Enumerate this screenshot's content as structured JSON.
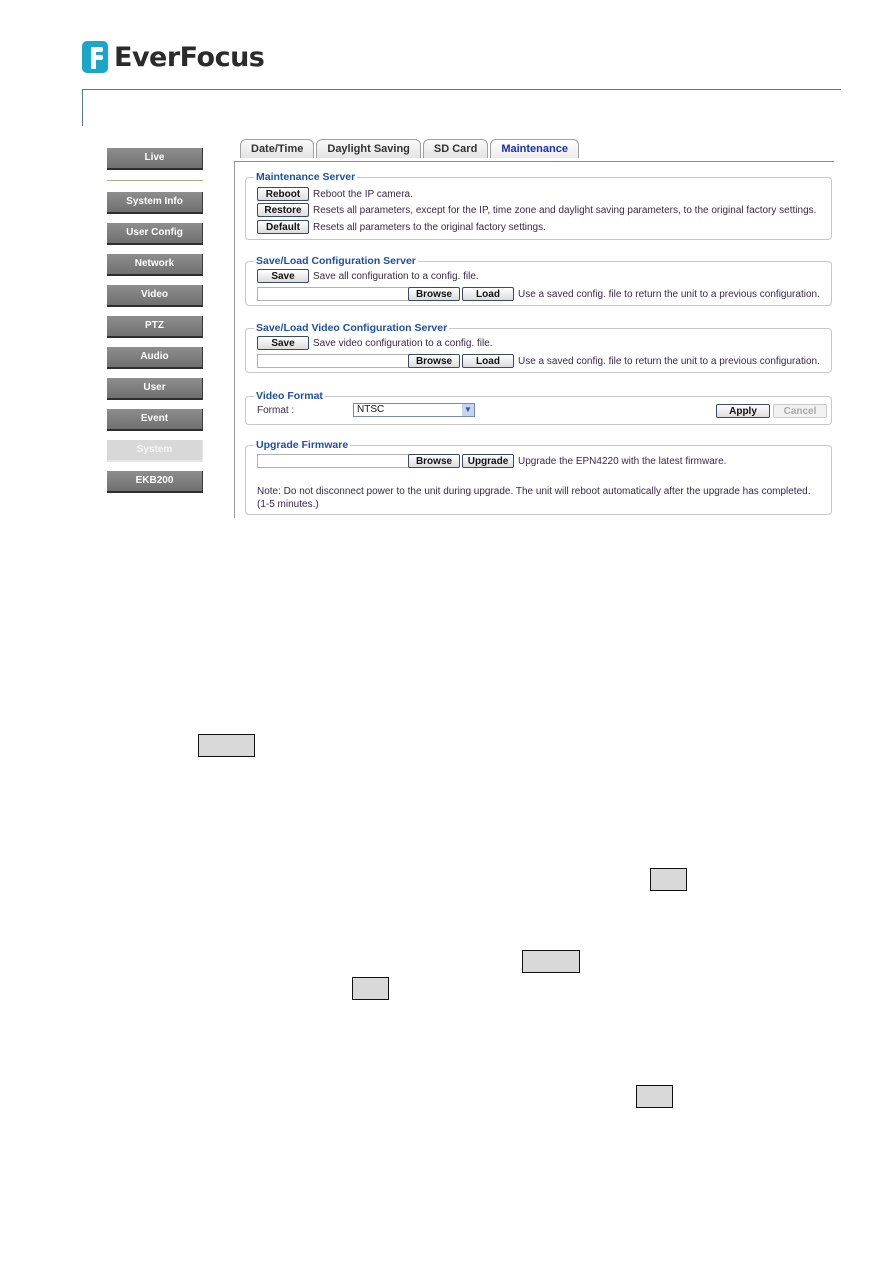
{
  "brand": {
    "name": "EverFocus",
    "logo_color": "#19a6c8"
  },
  "sidebar": {
    "items": [
      {
        "label": "Live",
        "active": false
      },
      {
        "label": "System Info",
        "active": false
      },
      {
        "label": "User Config",
        "active": false
      },
      {
        "label": "Network",
        "active": false
      },
      {
        "label": "Video",
        "active": false
      },
      {
        "label": "PTZ",
        "active": false
      },
      {
        "label": "Audio",
        "active": false
      },
      {
        "label": "User",
        "active": false
      },
      {
        "label": "Event",
        "active": false
      },
      {
        "label": "System",
        "active": true
      },
      {
        "label": "EKB200",
        "active": false
      }
    ]
  },
  "tabs": [
    {
      "label": "Date/Time",
      "active": false
    },
    {
      "label": "Daylight Saving",
      "active": false
    },
    {
      "label": "SD Card",
      "active": false
    },
    {
      "label": "Maintenance",
      "active": true
    }
  ],
  "maintenance_server": {
    "title": "Maintenance Server",
    "rows": [
      {
        "button": "Reboot",
        "desc": "Reboot the IP camera."
      },
      {
        "button": "Restore",
        "desc": "Resets all parameters, except for the IP, time zone and daylight saving parameters, to the original factory settings."
      },
      {
        "button": "Default",
        "desc": "Resets all parameters to the original factory settings."
      }
    ]
  },
  "config_server": {
    "title": "Save/Load Configuration Server",
    "save_button": "Save",
    "save_desc": "Save all configuration to a config. file.",
    "file_value": "",
    "browse_button": "Browse",
    "load_button": "Load",
    "load_desc": "Use a saved config. file to return the unit to a previous configuration."
  },
  "video_config_server": {
    "title": "Save/Load Video Configuration Server",
    "save_button": "Save",
    "save_desc": "Save video configuration to a config. file.",
    "file_value": "",
    "browse_button": "Browse",
    "load_button": "Load",
    "load_desc": "Use a saved config. file to return the unit to a previous configuration."
  },
  "video_format": {
    "title": "Video Format",
    "label": "Format :",
    "selected": "NTSC",
    "apply_button": "Apply",
    "cancel_button": "Cancel"
  },
  "upgrade_firmware": {
    "title": "Upgrade Firmware",
    "file_value": "",
    "browse_button": "Browse",
    "upgrade_button": "Upgrade",
    "desc": "Upgrade the EPN4220 with the latest firmware.",
    "note_line1": "Note: Do not disconnect power to the unit during upgrade. The unit will reboot automatically after the upgrade has completed.",
    "note_line2": "(1-5 minutes.)"
  },
  "callouts": [
    "",
    "",
    "",
    "",
    "",
    ""
  ]
}
